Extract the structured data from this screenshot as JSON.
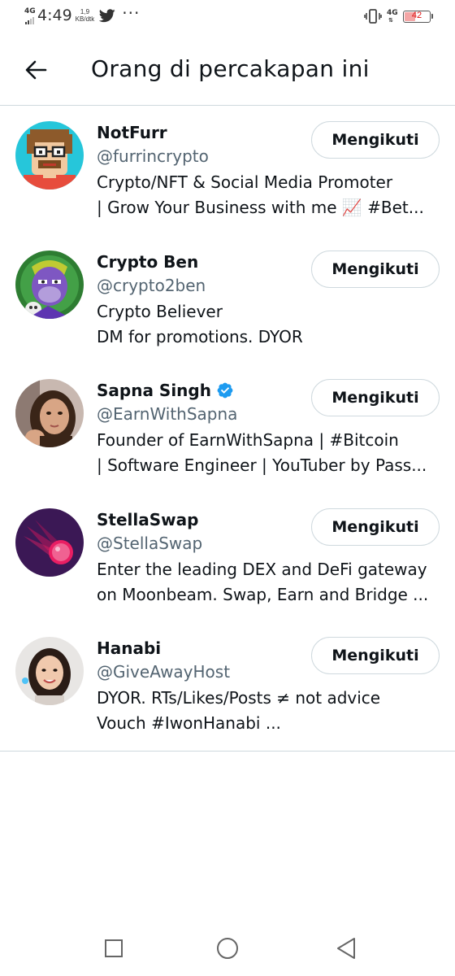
{
  "status_bar": {
    "network_left": "4G",
    "time": "4:49",
    "speed_value": "1,9",
    "speed_unit": "KB/dtk",
    "network_right": "4G",
    "battery_level": "42",
    "battery_fraction": 0.42,
    "battery_color": "#e02020",
    "icons": [
      "signal-icon",
      "twitter-bird-icon",
      "more-notifications-icon",
      "vibrate-icon",
      "battery-icon"
    ]
  },
  "header": {
    "back_icon": "arrow-left-icon",
    "title": "Orang di percakapan ini"
  },
  "users": [
    {
      "name": "NotFurr",
      "handle": "@furrincrypto",
      "verified": false,
      "bio": [
        "Crypto/NFT & Social Media Promoter",
        "| Grow Your Business with me 📈 #Bet..."
      ],
      "follow_label": "Mengikuti",
      "avatar": "pixel-art-avatar"
    },
    {
      "name": "Crypto Ben",
      "handle": "@crypto2ben",
      "verified": false,
      "bio": [
        "Crypto Believer",
        "DM for promotions. DYOR"
      ],
      "follow_label": "Mengikuti",
      "avatar": "ape-avatar"
    },
    {
      "name": "Sapna Singh",
      "handle": "@EarnWithSapna",
      "verified": true,
      "bio": [
        "Founder of EarnWithSapna | #Bitcoin",
        "| Software Engineer | YouTuber by Pass..."
      ],
      "follow_label": "Mengikuti",
      "avatar": "photo-avatar"
    },
    {
      "name": "StellaSwap",
      "handle": "@StellaSwap",
      "verified": false,
      "bio": [
        "Enter the leading DEX and DeFi gateway",
        "on Moonbeam. Swap, Earn and Bridge ..."
      ],
      "follow_label": "Mengikuti",
      "avatar": "comet-logo-avatar"
    },
    {
      "name": "Hanabi",
      "handle": "@GiveAwayHost",
      "verified": false,
      "bio": [
        "DYOR. RTs/Likes/Posts ≠ not advice",
        "Vouch #IwonHanabi ..."
      ],
      "follow_label": "Mengikuti",
      "avatar": "photo-avatar"
    }
  ],
  "nav_bar": {
    "buttons": [
      "recent-apps-icon",
      "home-icon",
      "back-triangle-icon"
    ]
  },
  "colors": {
    "text_primary": "#0f1419",
    "text_secondary": "#536471",
    "border": "#cfd9de",
    "verified": "#1d9bf0",
    "background": "#ffffff"
  }
}
